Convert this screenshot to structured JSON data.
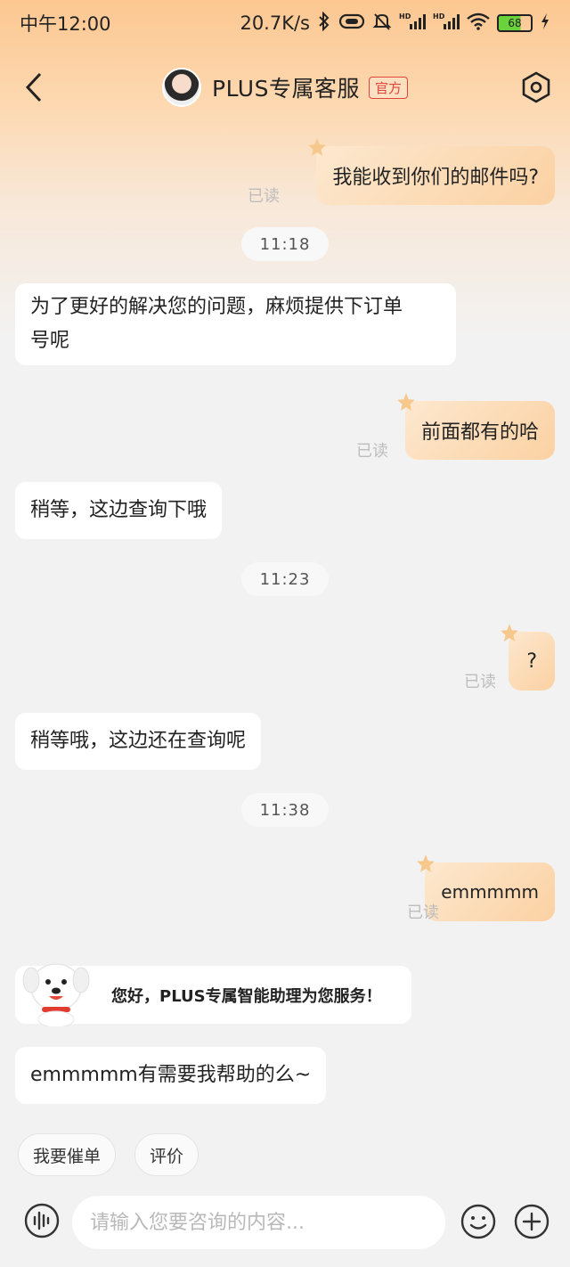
{
  "status_bar": {
    "time": "中午12:00",
    "network_speed": "20.7K/s",
    "battery_level": "68",
    "icons": [
      "bluetooth-icon",
      "vibrate-icon",
      "mute-icon",
      "hd-signal-icon",
      "hd-signal-icon",
      "wifi-icon",
      "battery-icon",
      "charging-icon"
    ]
  },
  "header": {
    "title": "PLUS专属客服",
    "badge": "官方"
  },
  "messages": [
    {
      "side": "out",
      "text": "我能收到你们的邮件吗?",
      "read": "已读"
    },
    {
      "type": "time",
      "text": "11:18"
    },
    {
      "side": "in",
      "text_line1": "为了更好的解决您的问题，麻烦提供下订单",
      "text_line2": "号呢"
    },
    {
      "side": "out",
      "text": "前面都有的哈",
      "read": "已读"
    },
    {
      "side": "in",
      "text": "稍等，这边查询下哦"
    },
    {
      "type": "time",
      "text": "11:23"
    },
    {
      "side": "out",
      "text": "?",
      "read": "已读"
    },
    {
      "side": "in",
      "text": "稍等哦，这边还在查询呢"
    },
    {
      "type": "time",
      "text": "11:38"
    },
    {
      "side": "out",
      "text": "emmmmm",
      "read": "已读"
    },
    {
      "side": "in",
      "type": "bot",
      "text": "您好，PLUS专属智能助理为您服务！"
    },
    {
      "side": "in",
      "text": "emmmmm有需要我帮助的么~"
    }
  ],
  "quick_replies": [
    "我要催单",
    "评价"
  ],
  "input": {
    "placeholder": "请输入您要咨询的内容...",
    "value": ""
  },
  "colors": {
    "accent_orange": "#fbd1a2",
    "badge_red": "#e2453c",
    "background": "#f2f2f2"
  }
}
